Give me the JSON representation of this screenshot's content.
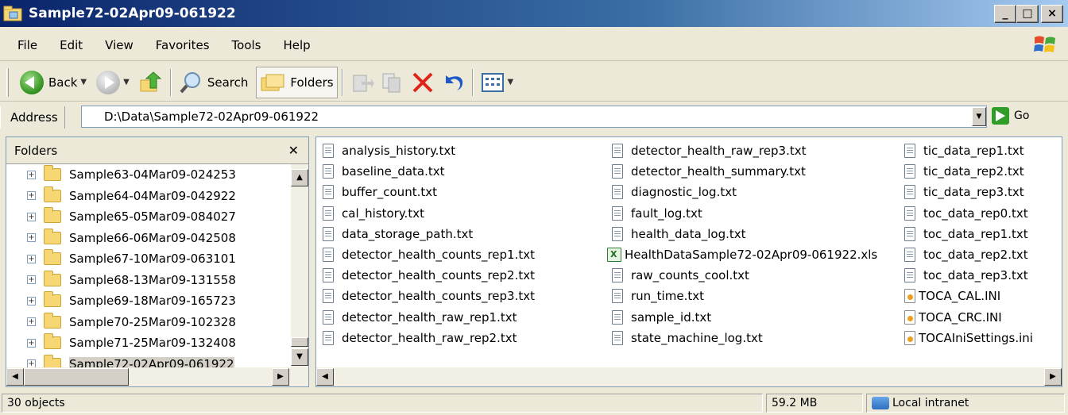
{
  "window": {
    "title": "Sample72-02Apr09-061922"
  },
  "menu": [
    "File",
    "Edit",
    "View",
    "Favorites",
    "Tools",
    "Help"
  ],
  "toolbar": {
    "back_label": "Back",
    "search_label": "Search",
    "folders_label": "Folders"
  },
  "address": {
    "label": "Address",
    "value": "D:\\Data\\Sample72-02Apr09-061922",
    "go_label": "Go"
  },
  "folders_pane": {
    "title": "Folders",
    "items": [
      "Sample63-04Mar09-024253",
      "Sample64-04Mar09-042922",
      "Sample65-05Mar09-084027",
      "Sample66-06Mar09-042508",
      "Sample67-10Mar09-063101",
      "Sample68-13Mar09-131558",
      "Sample69-18Mar09-165723",
      "Sample70-25Mar09-102328",
      "Sample71-25Mar09-132408",
      "Sample72-02Apr09-061922"
    ]
  },
  "files": {
    "col1": [
      "analysis_history.txt",
      "baseline_data.txt",
      "buffer_count.txt",
      "cal_history.txt",
      "data_storage_path.txt",
      "detector_health_counts_rep1.txt",
      "detector_health_counts_rep2.txt",
      "detector_health_counts_rep3.txt",
      "detector_health_raw_rep1.txt",
      "detector_health_raw_rep2.txt"
    ],
    "col2": [
      "detector_health_raw_rep3.txt",
      "detector_health_summary.txt",
      "diagnostic_log.txt",
      "fault_log.txt",
      "health_data_log.txt",
      "HealthDataSample72-02Apr09-061922.xls",
      "raw_counts_cool.txt",
      "run_time.txt",
      "sample_id.txt",
      "state_machine_log.txt"
    ],
    "col3": [
      "tic_data_rep1.txt",
      "tic_data_rep2.txt",
      "tic_data_rep3.txt",
      "toc_data_rep0.txt",
      "toc_data_rep1.txt",
      "toc_data_rep2.txt",
      "toc_data_rep3.txt",
      "TOCA_CAL.INI",
      "TOCA_CRC.INI",
      "TOCAIniSettings.ini"
    ]
  },
  "status": {
    "objects": "30 objects",
    "size": "59.2 MB",
    "zone": "Local intranet"
  }
}
